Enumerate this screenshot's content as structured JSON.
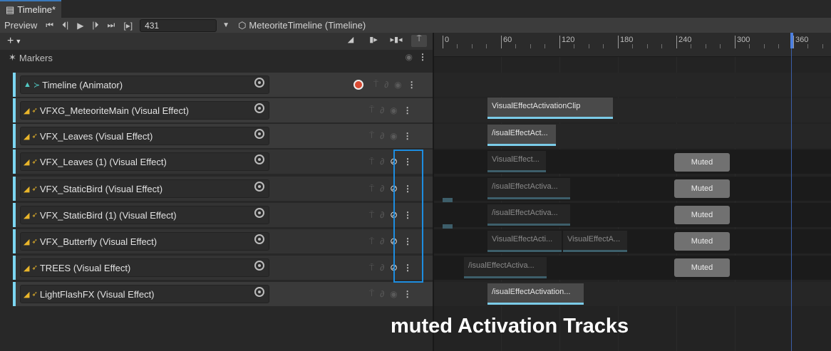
{
  "window": {
    "tab_title": "Timeline*"
  },
  "toolbar": {
    "preview_label": "Preview",
    "frame_value": "431",
    "breadcrumb": "MeteoriteTimeline (Timeline)"
  },
  "markers": {
    "label": "Markers"
  },
  "ruler": {
    "labels": [
      "0",
      "60",
      "120",
      "180",
      "240",
      "300",
      "360"
    ]
  },
  "tracks": [
    {
      "name": "Timeline (Animator)",
      "type": "animator",
      "muted": false
    },
    {
      "name": "VFXG_MeteoriteMain (Visual Effect)",
      "type": "vfx",
      "muted": false
    },
    {
      "name": "VFX_Leaves (Visual Effect)",
      "type": "vfx",
      "muted": false
    },
    {
      "name": "VFX_Leaves (1) (Visual Effect)",
      "type": "vfx",
      "muted": true
    },
    {
      "name": "VFX_StaticBird (Visual Effect)",
      "type": "vfx",
      "muted": true
    },
    {
      "name": "VFX_StaticBird (1) (Visual Effect)",
      "type": "vfx",
      "muted": true
    },
    {
      "name": "VFX_Butterfly (Visual Effect)",
      "type": "vfx",
      "muted": true
    },
    {
      "name": "TREES (Visual Effect)",
      "type": "vfx",
      "muted": true
    },
    {
      "name": "LightFlashFX (Visual Effect)",
      "type": "vfx",
      "muted": false
    }
  ],
  "clips": {
    "c1": "VisualEffectActivationClip",
    "c2": "/isualEffectAct...",
    "c3": "VisualEffect...",
    "c4": "/isualEffectActiva...",
    "c5": "/isualEffectActiva...",
    "c6a": "VisualEffectActi...",
    "c6b": "VisualEffectA...",
    "c7": "/isualEffectActiva...",
    "c8": "/isualEffectActivation..."
  },
  "muted_badge": "Muted",
  "caption": "muted Activation Tracks",
  "colors": {
    "track_accent": "#7cd6f2",
    "highlight_box": "#1d8de0",
    "playhead": "#4c7fe0"
  }
}
